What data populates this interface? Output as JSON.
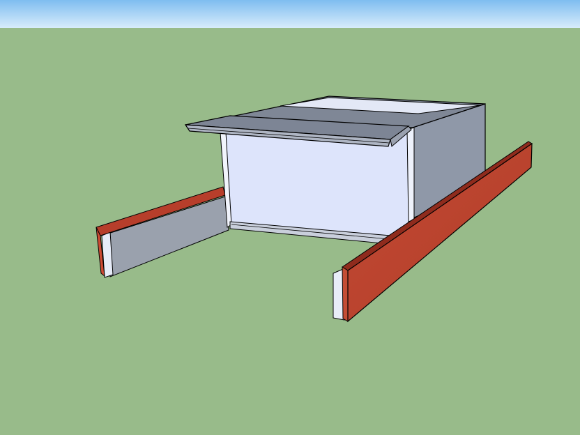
{
  "scene": {
    "sky_color_top": "#86c2f0",
    "sky_color_bottom": "#d9eefc",
    "ground_color": "#98bb8a",
    "edge_color": "#000000",
    "face_light_color": "#dde5fb",
    "face_shade_color": "#8e97a6",
    "face_top_color": "#7f8796",
    "board_red_color": "#b9402d",
    "board_red_dark_color": "#8f2b1d"
  },
  "objects": {
    "cabinet_box": "cabinet-box",
    "top_molding": "top-molding",
    "left_rail": "left-rail",
    "right_rail": "right-rail"
  }
}
